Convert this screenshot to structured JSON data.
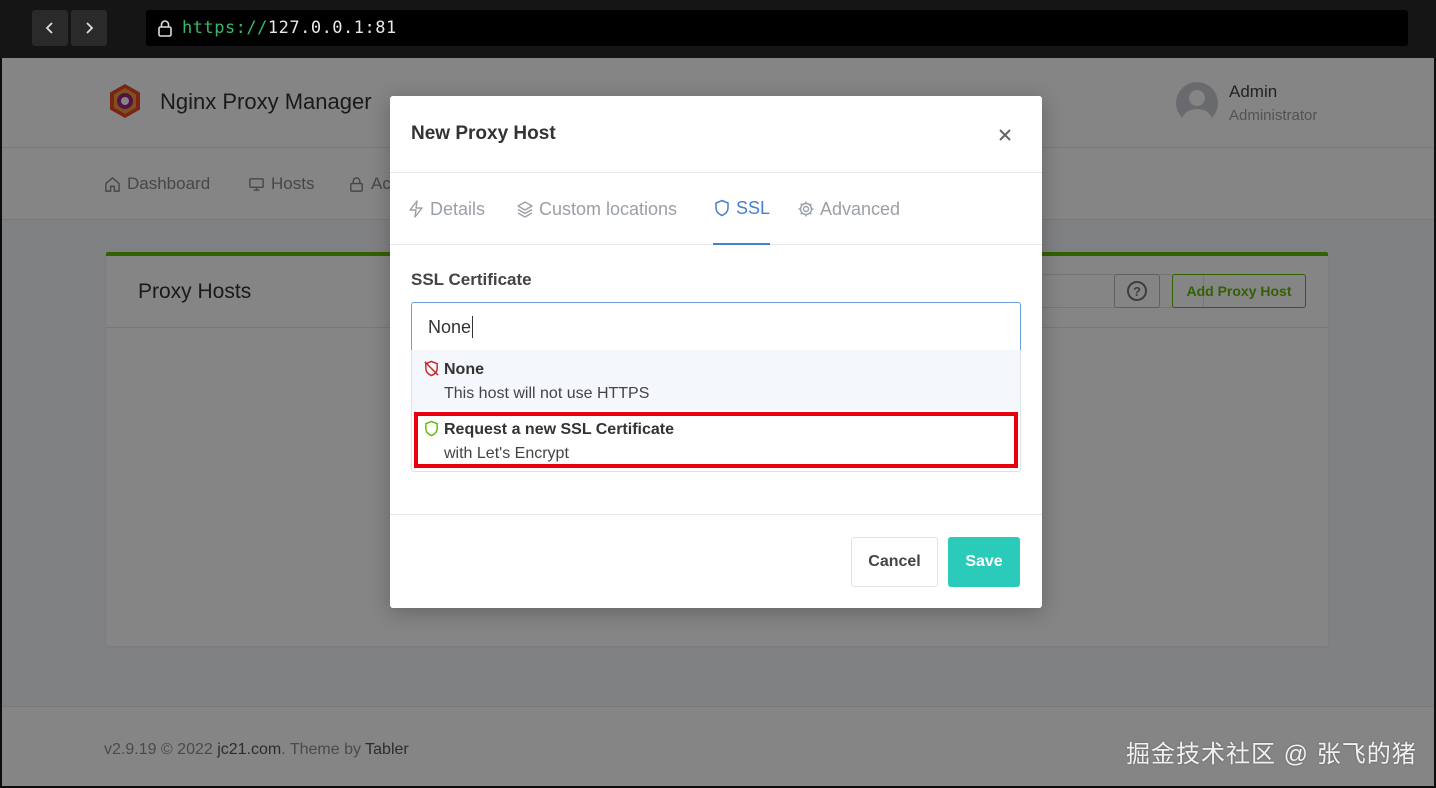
{
  "browser": {
    "url_scheme": "https://",
    "url_host": "127.0.0.1:81"
  },
  "app": {
    "title": "Nginx Proxy Manager",
    "user_name": "Admin",
    "user_role": "Administrator"
  },
  "nav": {
    "items": [
      {
        "label": "Dashboard",
        "icon": "home-icon"
      },
      {
        "label": "Hosts",
        "icon": "monitor-icon"
      },
      {
        "label": "Ac",
        "icon": "lock-icon"
      }
    ]
  },
  "card": {
    "title": "Proxy Hosts",
    "add_button": "Add Proxy Host",
    "help_button": "?"
  },
  "footer": {
    "version": "v2.9.19 © 2022 ",
    "author": "jc21.com",
    "theme_prefix": ". Theme by ",
    "theme": "Tabler"
  },
  "modal": {
    "title": "New Proxy Host",
    "tabs": [
      {
        "label": "Details",
        "icon": "zap-icon"
      },
      {
        "label": "Custom locations",
        "icon": "layers-icon"
      },
      {
        "label": "SSL",
        "icon": "shield-icon",
        "active": true
      },
      {
        "label": "Advanced",
        "icon": "settings-icon"
      }
    ],
    "ssl_label": "SSL Certificate",
    "ssl_value": "None",
    "options": [
      {
        "title": "None",
        "description": "This host will not use HTTPS",
        "icon": "shield-off-icon"
      },
      {
        "title": "Request a new SSL Certificate",
        "description": "with Let's Encrypt",
        "icon": "shield-icon"
      }
    ],
    "cancel": "Cancel",
    "save": "Save"
  },
  "colors": {
    "accent": "#467fcf",
    "success": "#5eba00",
    "save": "#2bcbba",
    "highlight": "#e8000d"
  },
  "watermark": "掘金技术社区 @ 张飞的猪"
}
